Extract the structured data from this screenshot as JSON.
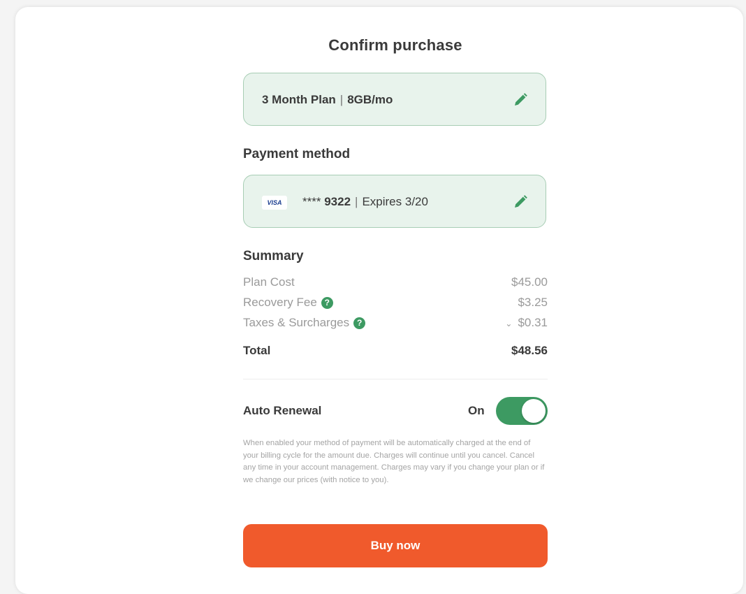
{
  "title": "Confirm purchase",
  "plan": {
    "name": "3 Month Plan",
    "separator": "|",
    "data": "8GB/mo"
  },
  "payment": {
    "section_label": "Payment method",
    "card_brand": "VISA",
    "masked_prefix": "****",
    "last4": "9322",
    "separator": "|",
    "expiry": "Expires 3/20"
  },
  "summary": {
    "section_label": "Summary",
    "rows": [
      {
        "label": "Plan Cost",
        "value": "$45.00"
      },
      {
        "label": "Recovery Fee",
        "value": "$3.25"
      },
      {
        "label": "Taxes & Surcharges",
        "value": "$0.31"
      }
    ],
    "total": {
      "label": "Total",
      "value": "$48.56"
    }
  },
  "auto_renewal": {
    "label": "Auto Renewal",
    "state_label": "On",
    "enabled": true,
    "notice": "When enabled your method of payment will be automatically charged at the end of your billing cycle for the amount due. Charges will continue until you cancel. Cancel any time in your account management. Charges may vary if you change your plan or if we change our prices (with notice to you)."
  },
  "buy_button": {
    "label": "Buy now"
  },
  "colors": {
    "accent_green": "#3d9a62",
    "card_background": "#e8f3ec",
    "buy_button": "#f05a2c"
  },
  "icons": {
    "edit": "pencil-icon",
    "help": "question-circle-icon",
    "expand": "chevron-down-icon"
  }
}
